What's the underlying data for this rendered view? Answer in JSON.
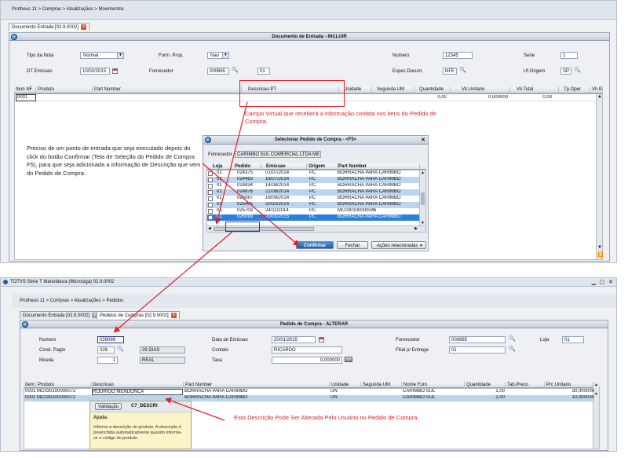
{
  "top": {
    "breadcrumb": "Protheus 11 > Compras > Atualizações > Movimentos",
    "tab_label": "Documento Entrada [02.9.0002]",
    "window_title": "Documento de Entrada - INCLUIR",
    "fields": {
      "tipo_nota_label": "Tipo da Nota",
      "tipo_nota_value": "Normal",
      "form_prop_label": "Form. Prop.",
      "form_prop_value": "Nao",
      "numero_label": "Numero",
      "numero_value": "12345",
      "serie_label": "Serie",
      "serie_value": "1",
      "dt_emissao_label": "DT Emissao",
      "dt_emissao_value": "10/02/2015",
      "fornecedor_label": "Fornecedor",
      "fornecedor_value": "000865",
      "loja_value": "01",
      "espec_label": "Espec.Docum.",
      "espec_value": "NFE",
      "uf_label": "Uf.Origem",
      "uf_value": "SP"
    },
    "grid_headers": [
      "Item NF",
      "Produto",
      "Part Number",
      "Descricao PT",
      "Unidade",
      "Segunda UM",
      "Quantidade",
      "Vlr.Unitario",
      "Vlr.Total",
      "Tp.Oper",
      "Vlr.IPI"
    ],
    "grid_row": {
      "item": "0001",
      "quantidade": "0,00",
      "vlr_unit": "0,000000",
      "vlr_total": "0,00"
    }
  },
  "annotations": {
    "campo_virtual": "Campo Virtual que receberá a informação contida nos itens do Pedido de Compra.",
    "left_note": "Preciso de um ponto de entrada que seja executado depois do click do botão  Confirmar (Tela de Seleção do Pedido de Compra F5), para que seja adicionada a informação de Descrição que vem do Pedido de Compra.",
    "bottom_note": "Esta Descrição Pode Ser Alterada Pelo Usuário no Pedido de Compra."
  },
  "dialog": {
    "title": "Selecionar Pedido de Compra - <F5>",
    "fornecedor_label": "Fornecedor",
    "fornecedor_value": "CARIMBO SUL COMERCIAL LTDA ME",
    "headers": [
      "Loja",
      "Pedido",
      "Emissao",
      "Origem",
      "Part Number"
    ],
    "rows": [
      {
        "loja": "01",
        "pedido": "024375",
        "emissao": "01/07/2014",
        "origem": "PC",
        "part": "BORRACHA PARA CARIMBO"
      },
      {
        "loja": "01",
        "pedido": "024463",
        "emissao": "16/07/2014",
        "origem": "PC",
        "part": "BORRACHA PARA CARIMBO"
      },
      {
        "loja": "01",
        "pedido": "024834",
        "emissao": "14/08/2014",
        "origem": "PC",
        "part": "BORRACHA PARA CARIMBO"
      },
      {
        "loja": "01",
        "pedido": "024876",
        "emissao": "21/08/2014",
        "origem": "PC",
        "part": "BORRACHA PARA CARIMBO"
      },
      {
        "loja": "01",
        "pedido": "025087",
        "emissao": "16/09/2014",
        "origem": "PC",
        "part": "BORRACHA PARA CARIMBO"
      },
      {
        "loja": "01",
        "pedido": "025405",
        "emissao": "20/10/2014",
        "origem": "PC",
        "part": "BORRACHA PARA CARIMBO"
      },
      {
        "loja": "01",
        "pedido": "025703",
        "emissao": "24/11/2014",
        "origem": "PC",
        "part": "MC030100000046"
      },
      {
        "loja": "01",
        "pedido": "026099",
        "emissao": "20/01/2015",
        "origem": "PC",
        "part": "BORRACHA PARA CARIMBO"
      }
    ],
    "confirm_label": "Confirmar",
    "close_label": "Fechar",
    "actions_label": "Ações relacionadas"
  },
  "bottom": {
    "app_title": "TOTVS Série T Manufatura (Microsiga) 02.9.0002",
    "breadcrumb": "Protheus 11 > Compras > Atualizações > Pedidos",
    "tab1_label": "Documento Entrada [02.9.0002]",
    "tab2_label": "Pedidos de Compras [02.9.0002]",
    "window_title": "Pedido de Compra - ALTERAR",
    "fields": {
      "numero_label": "Numero",
      "numero_value": "026099",
      "cond_label": "Cond. Pagto",
      "cond_value": "028",
      "cond_desc": "28 DIAS",
      "moeda_label": "Moeda",
      "moeda_value": "1",
      "moeda_desc": "REAL",
      "data_label": "Data de Emissao",
      "data_value": "20/01/2015",
      "contato_label": "Contato",
      "contato_value": "RICARDO",
      "taxa_label": "Taxa",
      "taxa_value": "0,000000",
      "fornecedor_label": "Fornecedor",
      "fornecedor_value": "000865",
      "loja_label": "Loja",
      "loja_value": "01",
      "filial_label": "Filial p/ Entrega",
      "filial_value": "01"
    },
    "grid_headers": [
      "Item",
      "Produto",
      "Descricao",
      "Part Number",
      "Unidade",
      "Segunda UM",
      "Nome Forn",
      "Quantidade",
      "Tab.Preco",
      "Prc Unitario"
    ],
    "rows": [
      {
        "item": "0001",
        "produto": "MC030100000072",
        "descricao": "RODRIGO MENDONCA",
        "part": "BORRACHA PARA CARIMBO",
        "un": "UN",
        "forn": "CARIMBO SUL",
        "qtd": "1,00",
        "preco": "30,000000"
      },
      {
        "item": "0002",
        "produto": "MC030100000072",
        "descricao": "",
        "part": "BORRACHA PARA CARIMBO",
        "un": "UN",
        "forn": "CARIMBO SUL",
        "qtd": "2,00",
        "preco": "10,000000"
      }
    ],
    "tooltip": {
      "validacao_label": "Validação",
      "field_name": "C7_DESCRI",
      "ajuda_label": "Ajuda:",
      "ajuda_text": "Informe a descrição do produto. A descrição é preenchida automaticamente quando informa-se o código do produto."
    }
  }
}
